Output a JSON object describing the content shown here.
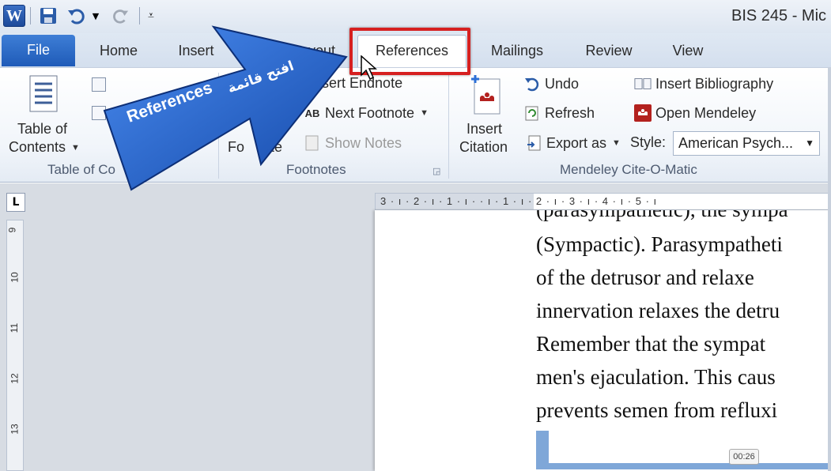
{
  "window": {
    "title": "BIS 245  -  Mic"
  },
  "qat": {
    "icons": [
      "word-logo",
      "save-icon",
      "undo-icon",
      "redo-icon",
      "customize-qat-icon"
    ],
    "logo_letter": "W"
  },
  "tabs": {
    "file": "File",
    "home": "Home",
    "insert": "Insert",
    "layout": "Layout",
    "references": "References",
    "mailings": "Mailings",
    "review": "Review",
    "view": "View"
  },
  "ribbon": {
    "toc": {
      "label_line1": "Table of",
      "label_line2": "Contents",
      "group": "Table of Co"
    },
    "footnotes": {
      "insert_endnote": "Insert Endnote",
      "next_footnote": "Next Footnote",
      "show_notes": "Show Notes",
      "insert_footnote_partial": "Fo",
      "insert_footnote_partial2": "ote",
      "group": "Footnotes"
    },
    "mendeley": {
      "insert_citation_line1": "Insert",
      "insert_citation_line2": "Citation",
      "undo": "Undo",
      "refresh": "Refresh",
      "export_as": "Export as",
      "style_label": "Style:",
      "style_value": "American Psych...",
      "insert_bibliography": "Insert Bibliography",
      "open_mendeley": "Open Mendeley",
      "group": "Mendeley Cite-O-Matic"
    }
  },
  "ruler": {
    "h_ticks": "3 · ı · 2 · ı · 1 · ı ·  · ı · 1 · ı · 2 · ı · 3 · ı · 4 · ı · 5 · ı",
    "v_numbers": [
      "9",
      "10",
      "11",
      "12",
      "13"
    ]
  },
  "document": {
    "lines": [
      "(parasympathetic), the sympa",
      "(Sympactic). Parasympatheti",
      "of  the  detrusor  and  relaxe",
      "innervation relaxes the detru",
      "Remember  that  the  sympat",
      "men's  ejaculation.  This  caus",
      "prevents semen from refluxi"
    ]
  },
  "overlay": {
    "arrow_text_en": "References",
    "arrow_text_ar": "افتح قائمة",
    "arrow_color": "#1f5fc8"
  },
  "video": {
    "timestamp": "00:26"
  },
  "colors": {
    "accent_red": "#d62020",
    "file_tab": "#2a66c4"
  }
}
